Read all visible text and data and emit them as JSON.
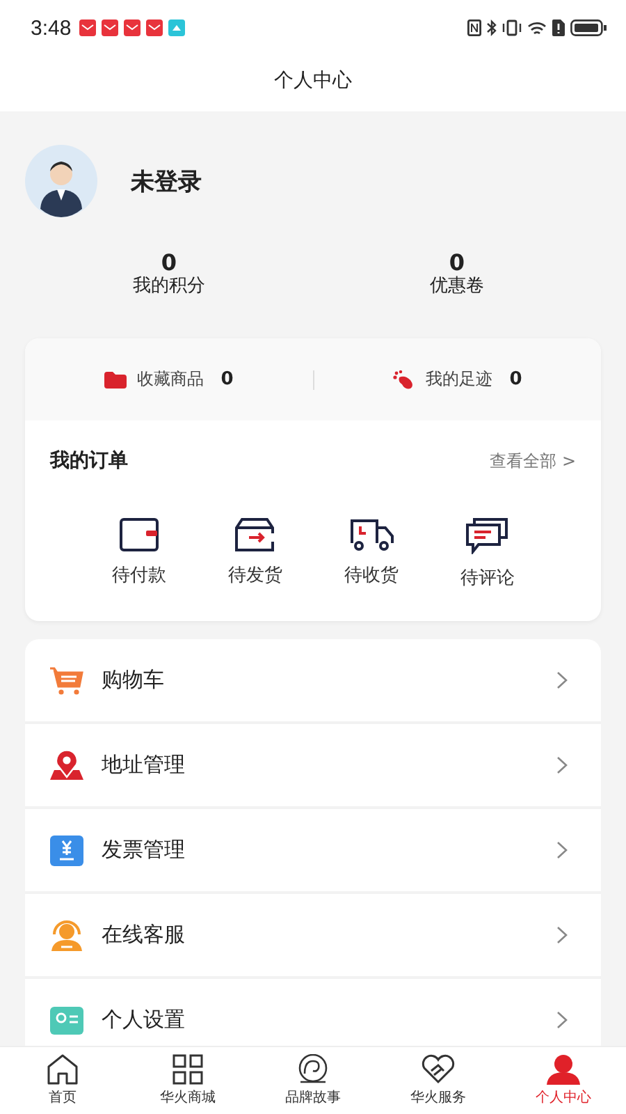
{
  "status_bar": {
    "time": "3:48"
  },
  "header": {
    "title": "个人中心"
  },
  "profile": {
    "name": "未登录"
  },
  "stats": [
    {
      "value": "0",
      "label": "我的积分"
    },
    {
      "value": "0",
      "label": "优惠卷"
    }
  ],
  "quick_links": [
    {
      "kind": "favorites",
      "label": "收藏商品",
      "count": "0"
    },
    {
      "kind": "footprints",
      "label": "我的足迹",
      "count": "0"
    }
  ],
  "orders": {
    "title": "我的订单",
    "view_all": "查看全部 >",
    "items": [
      {
        "kind": "unpaid",
        "label": "待付款"
      },
      {
        "kind": "unshipped",
        "label": "待发货"
      },
      {
        "kind": "shipping",
        "label": "待收货"
      },
      {
        "kind": "review",
        "label": "待评论"
      }
    ]
  },
  "menu": [
    {
      "kind": "cart",
      "label": "购物车"
    },
    {
      "kind": "address",
      "label": "地址管理"
    },
    {
      "kind": "invoice",
      "label": "发票管理"
    },
    {
      "kind": "service",
      "label": "在线客服"
    },
    {
      "kind": "settings",
      "label": "个人设置"
    }
  ],
  "tab_bar": [
    {
      "kind": "home",
      "label": "首页",
      "selected": false
    },
    {
      "kind": "mall",
      "label": "华火商城",
      "selected": false
    },
    {
      "kind": "story",
      "label": "品牌故事",
      "selected": false
    },
    {
      "kind": "service",
      "label": "华火服务",
      "selected": false
    },
    {
      "kind": "me",
      "label": "个人中心",
      "selected": true
    }
  ]
}
